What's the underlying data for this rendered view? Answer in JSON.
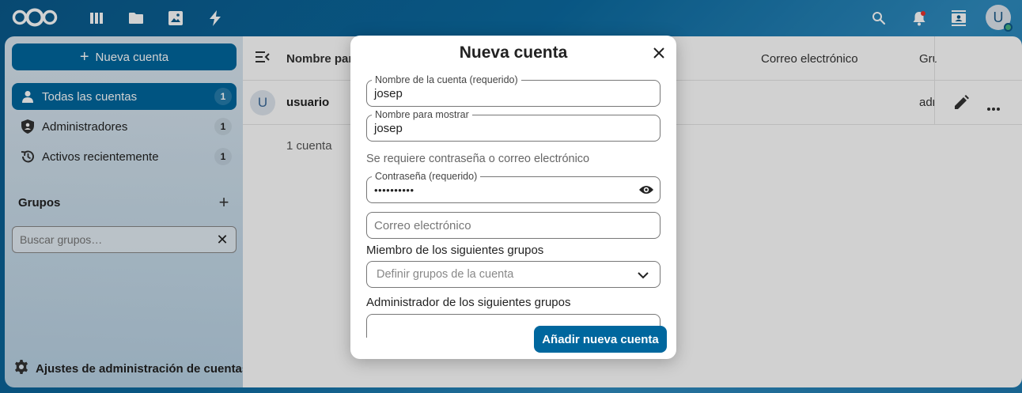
{
  "topbar": {
    "apps": [
      "dashboard-icon",
      "files-icon",
      "photos-icon",
      "activity-icon"
    ],
    "right_icons": [
      "search-icon",
      "notifications-icon",
      "contacts-icon"
    ],
    "avatar_letter": "U"
  },
  "sidebar": {
    "new_account_label": "Nueva cuenta",
    "items": [
      {
        "label": "Todas las cuentas",
        "count": "1",
        "icon": "user-icon"
      },
      {
        "label": "Administradores",
        "count": "1",
        "icon": "shield-icon"
      },
      {
        "label": "Activos recientemente",
        "count": "1",
        "icon": "history-icon"
      }
    ],
    "groups_title": "Grupos",
    "group_search_placeholder": "Buscar grupos…",
    "settings_label": "Ajustes de administración de cuentas"
  },
  "main": {
    "headers": {
      "name": "Nombre par",
      "email": "Correo electrónico",
      "groups": "Gru"
    },
    "rows": [
      {
        "avatar": "U",
        "name": "usuario",
        "group": "adr"
      }
    ],
    "total": "1 cuenta"
  },
  "modal": {
    "title": "Nueva cuenta",
    "account_name_label": "Nombre de la cuenta (requerido)",
    "account_name_value": "josep",
    "display_name_label": "Nombre para mostrar",
    "display_name_value": "josep",
    "hint": "Se requiere contraseña o correo electrónico",
    "password_label": "Contraseña (requerido)",
    "password_value": "••••••••••",
    "email_placeholder": "Correo electrónico",
    "member_groups_label": "Miembro de los siguientes grupos",
    "member_groups_placeholder": "Definir grupos de la cuenta",
    "admin_groups_label": "Administrador de los siguientes grupos",
    "submit_label": "Añadir nueva cuenta"
  },
  "colors": {
    "primary": "#00679e",
    "status_online": "#49b382"
  }
}
